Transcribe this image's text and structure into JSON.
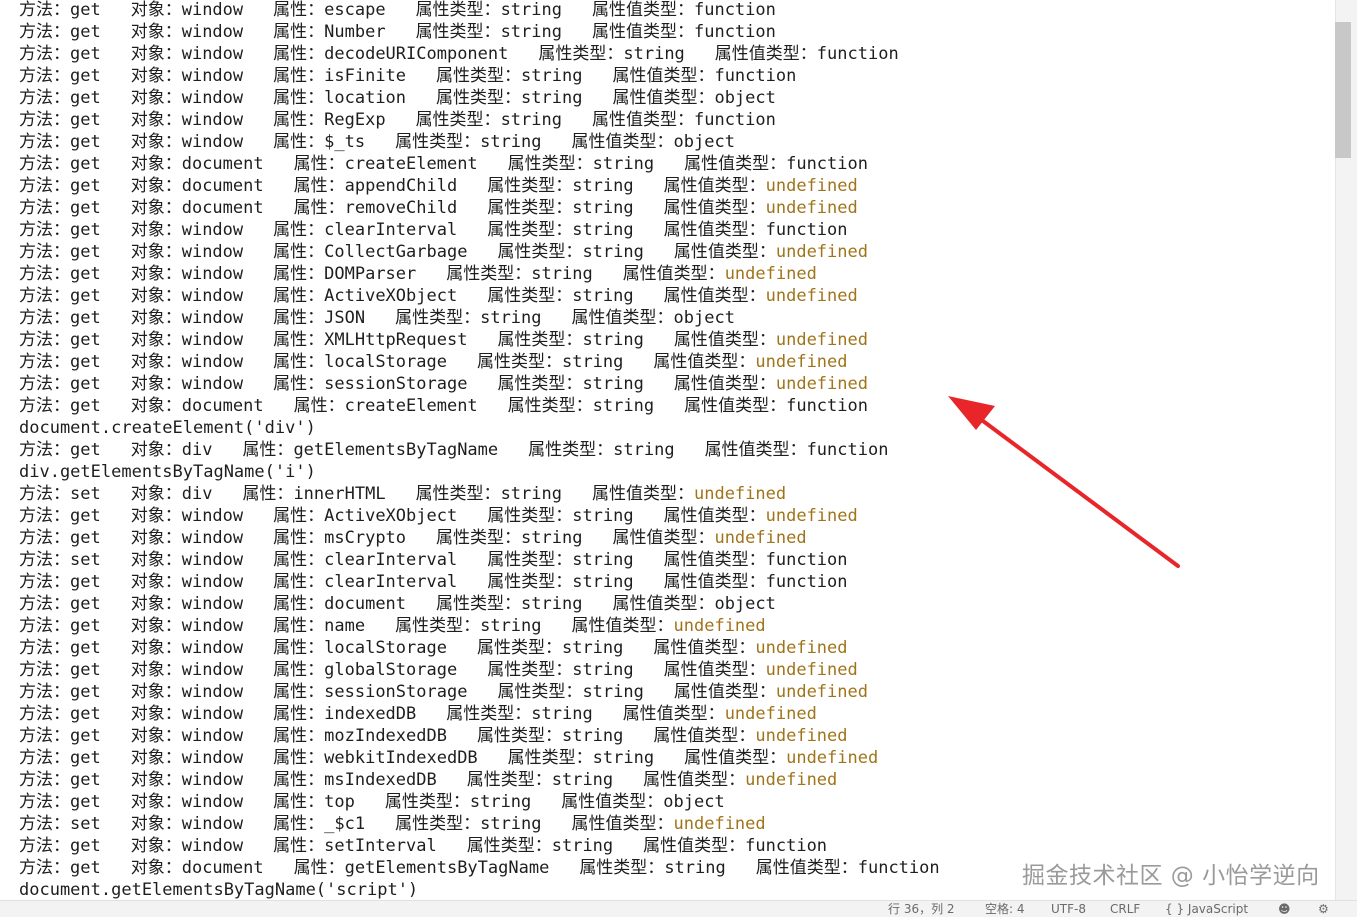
{
  "labels": {
    "method": "方法：",
    "object": "对象：",
    "property": "属性：",
    "property_type": "属性类型：",
    "property_value_type": "属性值类型："
  },
  "log_lines": [
    {
      "kind": "entry",
      "method": "get",
      "object": "window",
      "property": "escape",
      "ptype": "string",
      "vtype": "function"
    },
    {
      "kind": "entry",
      "method": "get",
      "object": "window",
      "property": "Number",
      "ptype": "string",
      "vtype": "function"
    },
    {
      "kind": "entry",
      "method": "get",
      "object": "window",
      "property": "decodeURIComponent",
      "ptype": "string",
      "vtype": "function"
    },
    {
      "kind": "entry",
      "method": "get",
      "object": "window",
      "property": "isFinite",
      "ptype": "string",
      "vtype": "function"
    },
    {
      "kind": "entry",
      "method": "get",
      "object": "window",
      "property": "location",
      "ptype": "string",
      "vtype": "object"
    },
    {
      "kind": "entry",
      "method": "get",
      "object": "window",
      "property": "RegExp",
      "ptype": "string",
      "vtype": "function"
    },
    {
      "kind": "entry",
      "method": "get",
      "object": "window",
      "property": "$_ts",
      "ptype": "string",
      "vtype": "object"
    },
    {
      "kind": "entry",
      "method": "get",
      "object": "document",
      "property": "createElement",
      "ptype": "string",
      "vtype": "function"
    },
    {
      "kind": "entry",
      "method": "get",
      "object": "document",
      "property": "appendChild",
      "ptype": "string",
      "vtype": "undefined"
    },
    {
      "kind": "entry",
      "method": "get",
      "object": "document",
      "property": "removeChild",
      "ptype": "string",
      "vtype": "undefined"
    },
    {
      "kind": "entry",
      "method": "get",
      "object": "window",
      "property": "clearInterval",
      "ptype": "string",
      "vtype": "function"
    },
    {
      "kind": "entry",
      "method": "get",
      "object": "window",
      "property": "CollectGarbage",
      "ptype": "string",
      "vtype": "undefined"
    },
    {
      "kind": "entry",
      "method": "get",
      "object": "window",
      "property": "DOMParser",
      "ptype": "string",
      "vtype": "undefined"
    },
    {
      "kind": "entry",
      "method": "get",
      "object": "window",
      "property": "ActiveXObject",
      "ptype": "string",
      "vtype": "undefined"
    },
    {
      "kind": "entry",
      "method": "get",
      "object": "window",
      "property": "JSON",
      "ptype": "string",
      "vtype": "object"
    },
    {
      "kind": "entry",
      "method": "get",
      "object": "window",
      "property": "XMLHttpRequest",
      "ptype": "string",
      "vtype": "undefined"
    },
    {
      "kind": "entry",
      "method": "get",
      "object": "window",
      "property": "localStorage",
      "ptype": "string",
      "vtype": "undefined"
    },
    {
      "kind": "entry",
      "method": "get",
      "object": "window",
      "property": "sessionStorage",
      "ptype": "string",
      "vtype": "undefined"
    },
    {
      "kind": "entry",
      "method": "get",
      "object": "document",
      "property": "createElement",
      "ptype": "string",
      "vtype": "function"
    },
    {
      "kind": "text",
      "text": "document.createElement('div')"
    },
    {
      "kind": "entry",
      "method": "get",
      "object": "div",
      "property": "getElementsByTagName",
      "ptype": "string",
      "vtype": "function"
    },
    {
      "kind": "text",
      "text": "div.getElementsByTagName('i')"
    },
    {
      "kind": "entry",
      "method": "set",
      "object": "div",
      "property": "innerHTML",
      "ptype": "string",
      "vtype": "undefined"
    },
    {
      "kind": "entry",
      "method": "get",
      "object": "window",
      "property": "ActiveXObject",
      "ptype": "string",
      "vtype": "undefined"
    },
    {
      "kind": "entry",
      "method": "get",
      "object": "window",
      "property": "msCrypto",
      "ptype": "string",
      "vtype": "undefined"
    },
    {
      "kind": "entry",
      "method": "set",
      "object": "window",
      "property": "clearInterval",
      "ptype": "string",
      "vtype": "function"
    },
    {
      "kind": "entry",
      "method": "get",
      "object": "window",
      "property": "clearInterval",
      "ptype": "string",
      "vtype": "function"
    },
    {
      "kind": "entry",
      "method": "get",
      "object": "window",
      "property": "document",
      "ptype": "string",
      "vtype": "object"
    },
    {
      "kind": "entry",
      "method": "get",
      "object": "window",
      "property": "name",
      "ptype": "string",
      "vtype": "undefined"
    },
    {
      "kind": "entry",
      "method": "get",
      "object": "window",
      "property": "localStorage",
      "ptype": "string",
      "vtype": "undefined"
    },
    {
      "kind": "entry",
      "method": "get",
      "object": "window",
      "property": "globalStorage",
      "ptype": "string",
      "vtype": "undefined"
    },
    {
      "kind": "entry",
      "method": "get",
      "object": "window",
      "property": "sessionStorage",
      "ptype": "string",
      "vtype": "undefined"
    },
    {
      "kind": "entry",
      "method": "get",
      "object": "window",
      "property": "indexedDB",
      "ptype": "string",
      "vtype": "undefined"
    },
    {
      "kind": "entry",
      "method": "get",
      "object": "window",
      "property": "mozIndexedDB",
      "ptype": "string",
      "vtype": "undefined"
    },
    {
      "kind": "entry",
      "method": "get",
      "object": "window",
      "property": "webkitIndexedDB",
      "ptype": "string",
      "vtype": "undefined"
    },
    {
      "kind": "entry",
      "method": "get",
      "object": "window",
      "property": "msIndexedDB",
      "ptype": "string",
      "vtype": "undefined"
    },
    {
      "kind": "entry",
      "method": "get",
      "object": "window",
      "property": "top",
      "ptype": "string",
      "vtype": "object"
    },
    {
      "kind": "entry",
      "method": "set",
      "object": "window",
      "property": "_$c1",
      "ptype": "string",
      "vtype": "undefined"
    },
    {
      "kind": "entry",
      "method": "get",
      "object": "window",
      "property": "setInterval",
      "ptype": "string",
      "vtype": "function"
    },
    {
      "kind": "entry",
      "method": "get",
      "object": "document",
      "property": "getElementsByTagName",
      "ptype": "string",
      "vtype": "function"
    },
    {
      "kind": "text",
      "text": "document.getElementsByTagName('script')"
    }
  ],
  "status_bar": {
    "line_col": "行 36，列 2",
    "spaces": "空格: 4",
    "encoding": "UTF-8",
    "eol": "CRLF",
    "language": "{ } JavaScript"
  },
  "watermark": "掘金技术社区 @ 小怡学逆向",
  "colors": {
    "text": "#1e1e1e",
    "undefined_value": "#a0741a",
    "arrow": "#e8262a"
  }
}
